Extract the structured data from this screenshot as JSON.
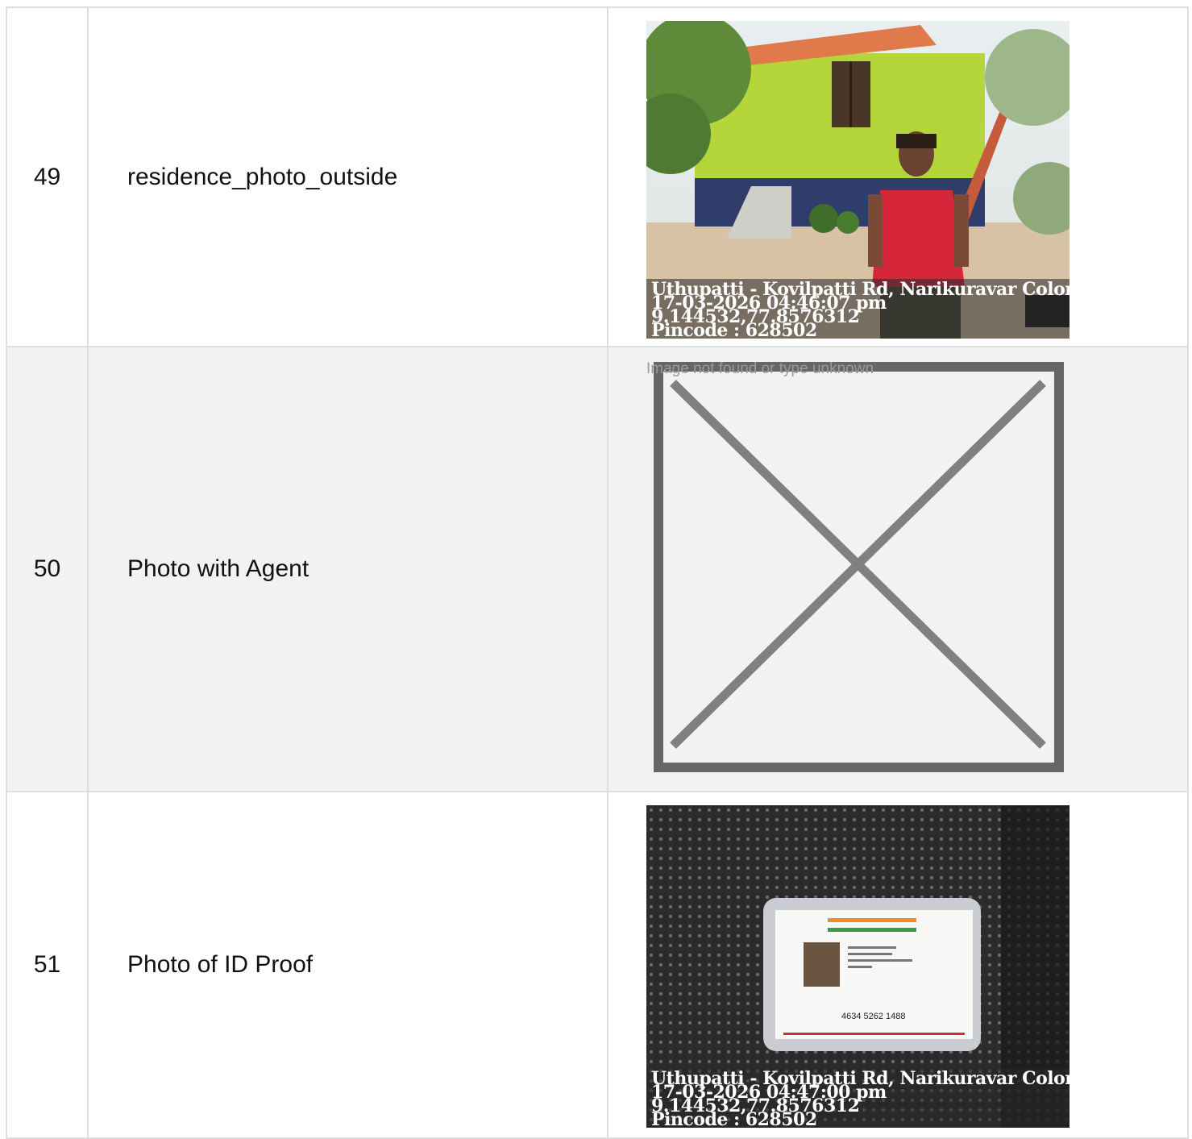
{
  "rows": [
    {
      "number": "49",
      "label": "residence_photo_outside",
      "image": {
        "type": "photo",
        "subject": "person standing outside green house",
        "overlay": {
          "address": "Uthupatti - Kovilpatti Rd, Narikuravar Colony, ...",
          "datetime": "17-03-2026 04:46:07 pm",
          "coords": "9.144532,77.8576312",
          "pincode": "Pincode : 628502"
        }
      }
    },
    {
      "number": "50",
      "label": "Photo with Agent",
      "image": {
        "type": "broken",
        "alt_text": "Image not found or type unknown"
      }
    },
    {
      "number": "51",
      "label": "Photo of ID Proof",
      "image": {
        "type": "photo",
        "subject": "ID card on perforated black surface",
        "card_number": "4634 5262 1488",
        "overlay": {
          "address": "Uthupatti - Kovilpatti Rd, Narikuravar Colony, ...",
          "datetime": "17-03-2026 04:47:00 pm",
          "coords": "9.144532,77.8576312",
          "pincode": "Pincode : 628502"
        }
      }
    }
  ],
  "colors": {
    "border": "#dedede",
    "alt_row": "#f2f2f2",
    "broken_frame": "#666666",
    "broken_cross": "#808080"
  }
}
